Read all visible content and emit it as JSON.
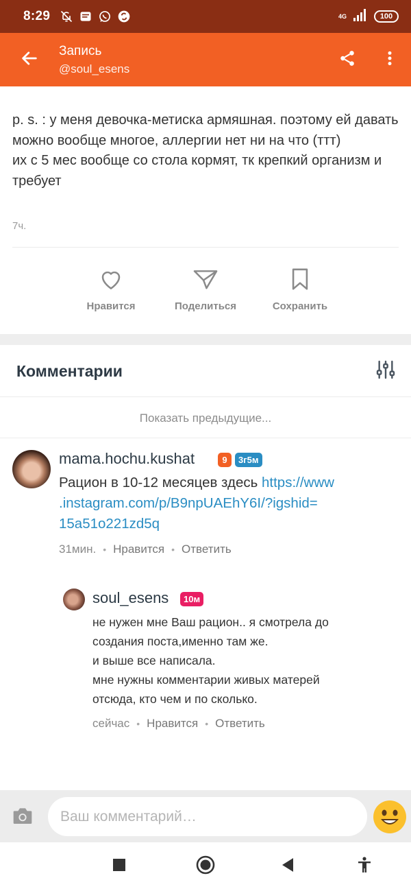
{
  "status_bar": {
    "time": "8:29",
    "network": "4G",
    "battery": "100"
  },
  "app_bar": {
    "title": "Запись",
    "subtitle": "@soul_esens"
  },
  "post": {
    "clipped_line": "...",
    "paragraphs": [
      "p. s. : у меня девочка-метиска армяшная. поэтому ей давать можно вообще многое, аллергии нет ни на что (ттт)",
      "их с 5 мес вообще со стола кормят, тк крепкий организм и требует"
    ],
    "time": "7ч.",
    "actions": {
      "like": "Нравится",
      "share": "Поделиться",
      "save": "Сохранить"
    }
  },
  "comments_section": {
    "title": "Комментарии",
    "show_previous": "Показать предыдущие...",
    "comments": [
      {
        "username": "mama.hochu.kushat",
        "level_badge": "9",
        "time_badge": "3г5м",
        "text_prefix": "Рацион в 10-12 месяцев здесь ",
        "link_line1": "https://www",
        "link_line2": ".instagram.com/p/B9npUAEhY6I/?igshid=",
        "link_line3": "15a51o221zd5q",
        "time": "31мин.",
        "like": "Нравится",
        "reply": "Ответить"
      },
      {
        "username": "soul_esens",
        "time_badge": "10м",
        "lines": [
          "не нужен мне Ваш рацион.. я смотрела до",
          "создания поста,именно там же.",
          "и выше все написала.",
          "мне нужны комментарии живых матерей",
          "отсюда, кто чем и по сколько."
        ],
        "time": "сейчас",
        "like": "Нравится",
        "reply": "Ответить"
      }
    ]
  },
  "comment_input": {
    "placeholder": "Ваш комментарий…"
  },
  "colors": {
    "app_bar": "#f26024",
    "status_bar": "#8a2e14",
    "link": "#2a8dc3",
    "level_badge": "#f26024",
    "time_badge_blue": "#2a8dc3",
    "time_badge_pink": "#e91e63"
  },
  "icons": {
    "back": "arrow-left-icon",
    "share": "share-icon",
    "more": "more-vert-icon",
    "like": "heart-outline-icon",
    "share_post": "paper-plane-icon",
    "save": "bookmark-outline-icon",
    "filter": "sliders-icon",
    "camera": "camera-icon",
    "emoji": "smile-emoji-icon"
  }
}
